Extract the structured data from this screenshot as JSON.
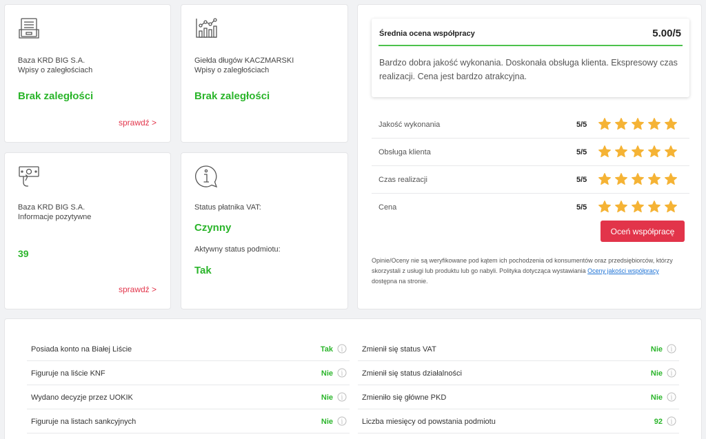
{
  "cards": {
    "krd_debts": {
      "line1": "Baza KRD BIG S.A.",
      "line2": "Wpisy o zaległościach",
      "status": "Brak zaległości",
      "link": "sprawdź >"
    },
    "kaczmarski": {
      "line1": "Giełda długów KACZMARSKI",
      "line2": "Wpisy o zaległościach",
      "status": "Brak zaległości"
    },
    "krd_positive": {
      "line1": "Baza KRD BIG S.A.",
      "line2": "Informacje pozytywne",
      "value": "39",
      "link": "sprawdź >"
    },
    "vat": {
      "vat_label": "Status płatnika VAT:",
      "vat_value": "Czynny",
      "active_label": "Aktywny status podmiotu:",
      "active_value": "Tak"
    }
  },
  "rating": {
    "avg_title": "Średnia ocena współpracy",
    "avg_score": "5.00/5",
    "comment": "Bardzo dobra jakość wykonania. Doskonała obsługa klienta. Ekspresowy czas realizacji. Cena jest bardzo atrakcyjna.",
    "rows": [
      {
        "label": "Jakość wykonania",
        "value": "5/5",
        "stars": 5
      },
      {
        "label": "Obsługa klienta",
        "value": "5/5",
        "stars": 5
      },
      {
        "label": "Czas realizacji",
        "value": "5/5",
        "stars": 5
      },
      {
        "label": "Cena",
        "value": "5/5",
        "stars": 5
      }
    ],
    "button": "Oceń współpracę",
    "disclaimer_text": "Opinie/Oceny nie są weryfikowane pod kątem ich pochodzenia od konsumentów oraz przedsiębiorców, którzy skorzystali z usługi lub produktu lub go nabyli. Polityka dotycząca wystawiania ",
    "disclaimer_link": "Oceny jakości współpracy",
    "disclaimer_tail": " dostępna na stronie.",
    "star_color": "#f5b335"
  },
  "checks": {
    "left": [
      {
        "label": "Posiada konto na Białej Liście",
        "value": "Tak"
      },
      {
        "label": "Figuruje na liście KNF",
        "value": "Nie"
      },
      {
        "label": "Wydano decyzje przez UOKIK",
        "value": "Nie"
      },
      {
        "label": "Figuruje na listach sankcyjnych",
        "value": "Nie"
      }
    ],
    "right": [
      {
        "label": "Zmienił się status VAT",
        "value": "Nie"
      },
      {
        "label": "Zmienił się status działalności",
        "value": "Nie"
      },
      {
        "label": "Zmieniło się główne PKD",
        "value": "Nie"
      },
      {
        "label": "Liczba miesięcy od powstania podmiotu",
        "value": "92"
      }
    ]
  },
  "colors": {
    "green": "#2bb52b",
    "red": "#e2344a",
    "link_blue": "#1e73d6"
  }
}
